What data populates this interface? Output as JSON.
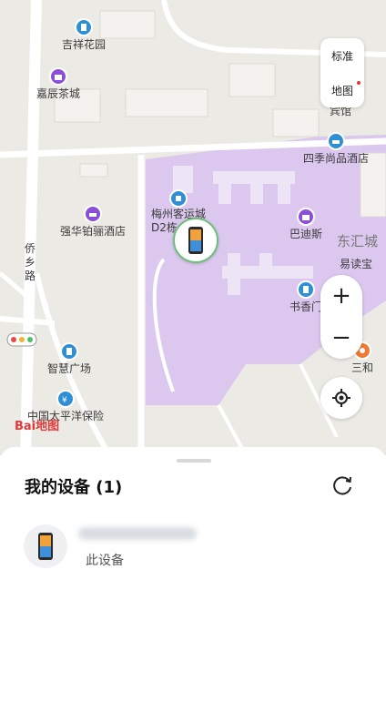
{
  "map": {
    "pois": {
      "jixiang": "吉祥花园",
      "jiachen": "嘉辰茶城",
      "siji": "四季尚品酒店",
      "meizhou": "梅州客运城",
      "meizhou_d2": "D2栋",
      "qianghua": "强华铂骊酒店",
      "badisi": "巴迪斯",
      "donghui": "东汇城",
      "yidubao": "易读宝",
      "shuxiang": "书香门",
      "zhihui": "智慧广场",
      "taipingyang": "中国太平洋保险",
      "sanhe": "三和",
      "qiaoxiang": "侨乡路",
      "binguan": "宾馆"
    },
    "logo_text": "Bai地图",
    "layer_buttons": {
      "standard": "标准",
      "map": "地图"
    },
    "zoom": {
      "in": "+",
      "out": "−"
    }
  },
  "sheet": {
    "title": "我的设备 (1)",
    "device": {
      "status": "此设备"
    }
  },
  "colors": {
    "campus": "#dcc8ef",
    "poi_blue": "#2f8fd6",
    "poi_purple": "#8a4fd6",
    "marker_ring": "#6cc07a"
  }
}
